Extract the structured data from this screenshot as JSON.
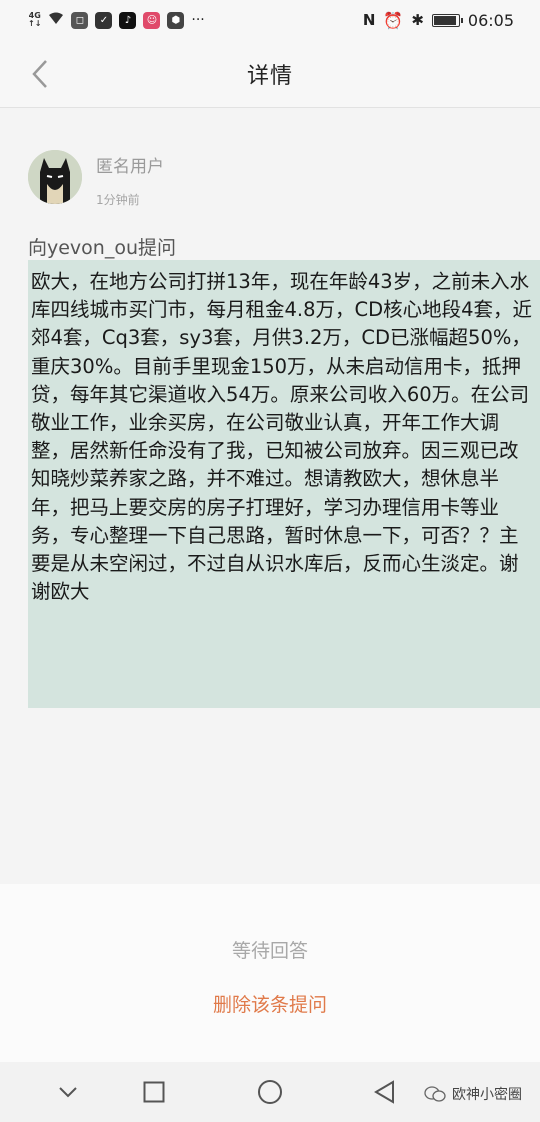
{
  "status_bar": {
    "signal_text": "4G",
    "signal_sub": "↑↓",
    "app_icons": [
      "app-icon-1",
      "shield-icon",
      "tiktok-icon",
      "baby-icon",
      "app-icon-2"
    ],
    "more": "···",
    "status_icons": [
      "nfc-icon",
      "alarm-icon",
      "bluetooth-icon"
    ],
    "battery_level": 0.85,
    "time": "06:05"
  },
  "header": {
    "title": "详情",
    "back_icon": "chevron-left-icon"
  },
  "question": {
    "user_name": "匿名用户",
    "time_ago": "1分钟前",
    "ask_to": "向yevon_ou提问",
    "body": "欧大，在地方公司打拼13年，现在年龄43岁，之前未入水库四线城市买门市，每月租金4.8万，CD核心地段4套，近郊4套，Cq3套，sy3套，月供3.2万，CD已涨幅超50%，重庆30%。目前手里现金150万，从未启动信用卡，抵押贷，每年其它渠道收入54万。原来公司收入60万。在公司敬业工作，业余买房，在公司敬业认真，开年工作大调整，居然新任命没有了我，已知被公司放弃。因三观已改知晓炒菜养家之路，并不难过。想请教欧大，想休息半年，把马上要交房的房子打理好，学习办理信用卡等业务，专心整理一下自己思路，暂时休息一下，可否？？主要是从未空闲过，不过自从识水库后，反而心生淡定。谢谢欧大"
  },
  "actions": {
    "status": "等待回答",
    "delete_label": "删除该条提问"
  },
  "navbar": {
    "icons": [
      "chevron-down-icon",
      "square-icon",
      "circle-icon",
      "triangle-back-icon"
    ],
    "watermark": "欧神小密圈",
    "colors": {
      "accent": "#e07a4a",
      "highlight": "#d4e4de"
    }
  }
}
